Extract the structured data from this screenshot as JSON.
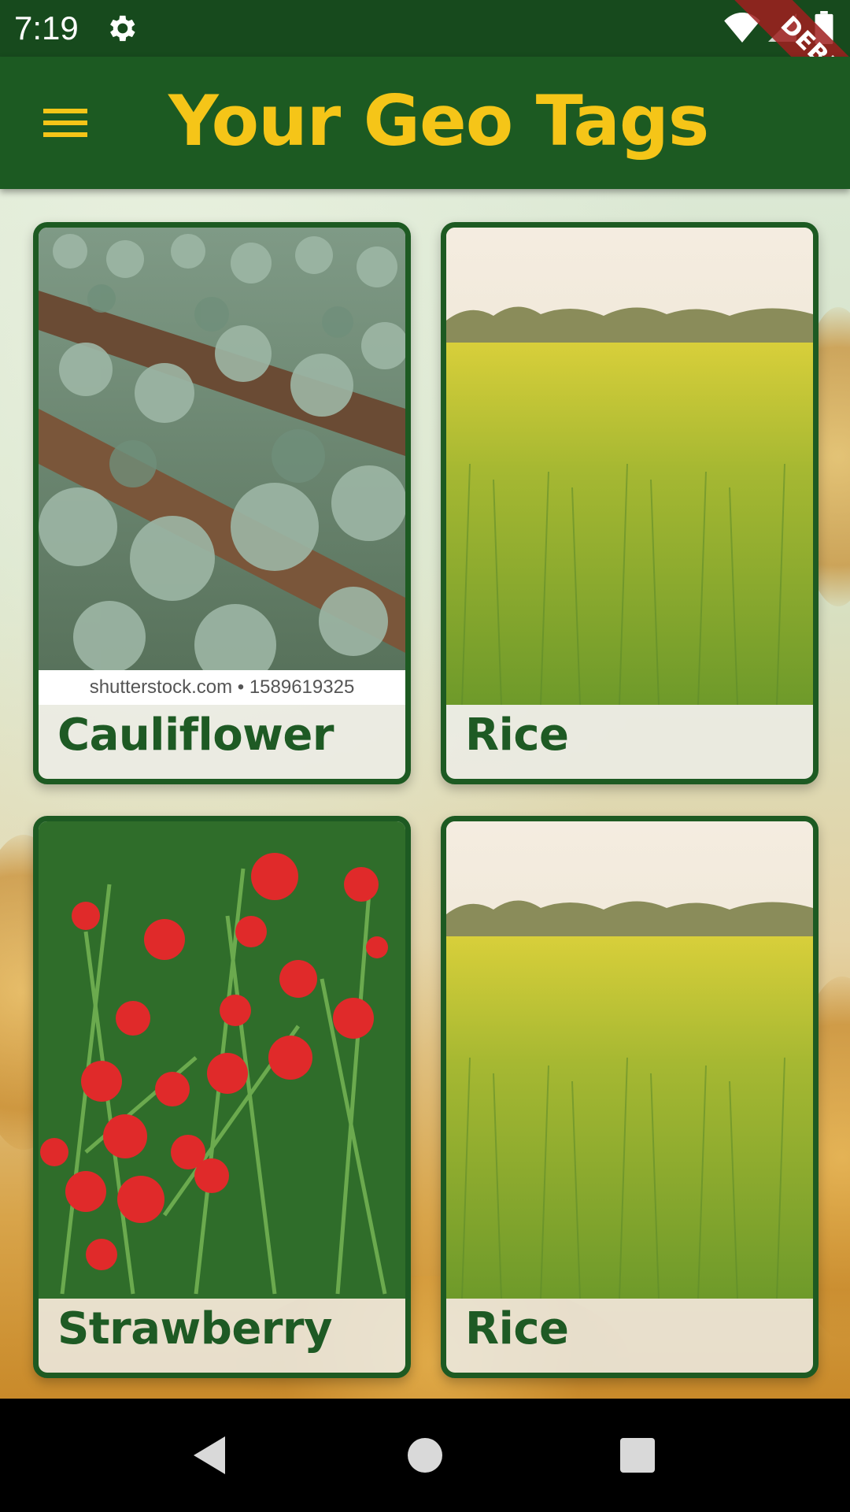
{
  "status_bar": {
    "time": "7:19",
    "icons": [
      "gear-icon",
      "wifi-icon",
      "signal-icon",
      "battery-icon"
    ]
  },
  "debug_banner": "DEBUG",
  "app_bar": {
    "title": "Your Geo Tags",
    "menu_icon": "hamburger-menu-icon"
  },
  "colors": {
    "app_bar": "#1c5a22",
    "status_bar": "#174a1d",
    "title": "#f5c518",
    "card_border": "#1d5a22",
    "label": "#1e5a24"
  },
  "cards": [
    {
      "label": "Cauliflower",
      "image": "cauliflower-field",
      "watermark": "shutterstock.com • 1589619325"
    },
    {
      "label": "Rice",
      "image": "rice-field"
    },
    {
      "label": "Strawberry",
      "image": "red-globe-flowers"
    },
    {
      "label": "Rice",
      "image": "rice-field"
    }
  ],
  "nav_bar": [
    "back-icon",
    "home-icon",
    "recents-icon"
  ]
}
